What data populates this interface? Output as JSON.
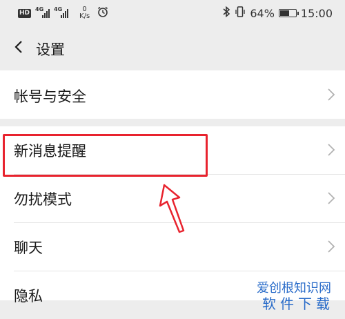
{
  "status_bar": {
    "hd": "HD",
    "network_1": "4G",
    "network_2": "4G",
    "speed_value": "0",
    "speed_unit": "K/s",
    "battery_percent": "64%",
    "battery_level": 0.64,
    "time": "15:00"
  },
  "nav": {
    "title": "设置"
  },
  "settings": {
    "account": "帐号与安全",
    "items": [
      {
        "label": "新消息提醒"
      },
      {
        "label": "勿扰模式"
      },
      {
        "label": "聊天"
      },
      {
        "label": "隐私"
      }
    ]
  },
  "annotation": {
    "highlight_color": "#e8232e"
  },
  "watermark": {
    "text": "爱创根知识网",
    "sub": "软件下载"
  }
}
